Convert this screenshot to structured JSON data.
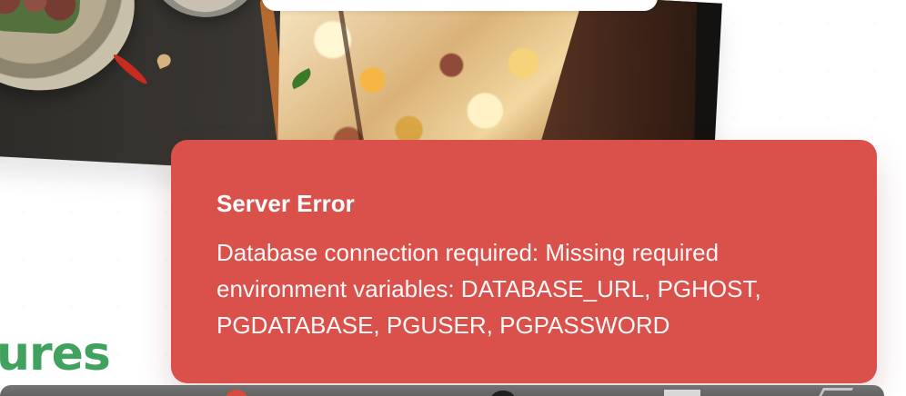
{
  "background": {
    "section_heading_fragment": "ures",
    "accent_color": "#41a15f",
    "image_subject": "food collage"
  },
  "error_toast": {
    "title": "Server Error",
    "message": "Database connection required: Missing required environment variables: DATABASE_URL, PGHOST, PGDATABASE, PGUSER, PGPASSWORD",
    "background_color": "#da504b",
    "text_color": "#ffffff"
  },
  "dock": {
    "background_color": "#5f5f5f"
  }
}
